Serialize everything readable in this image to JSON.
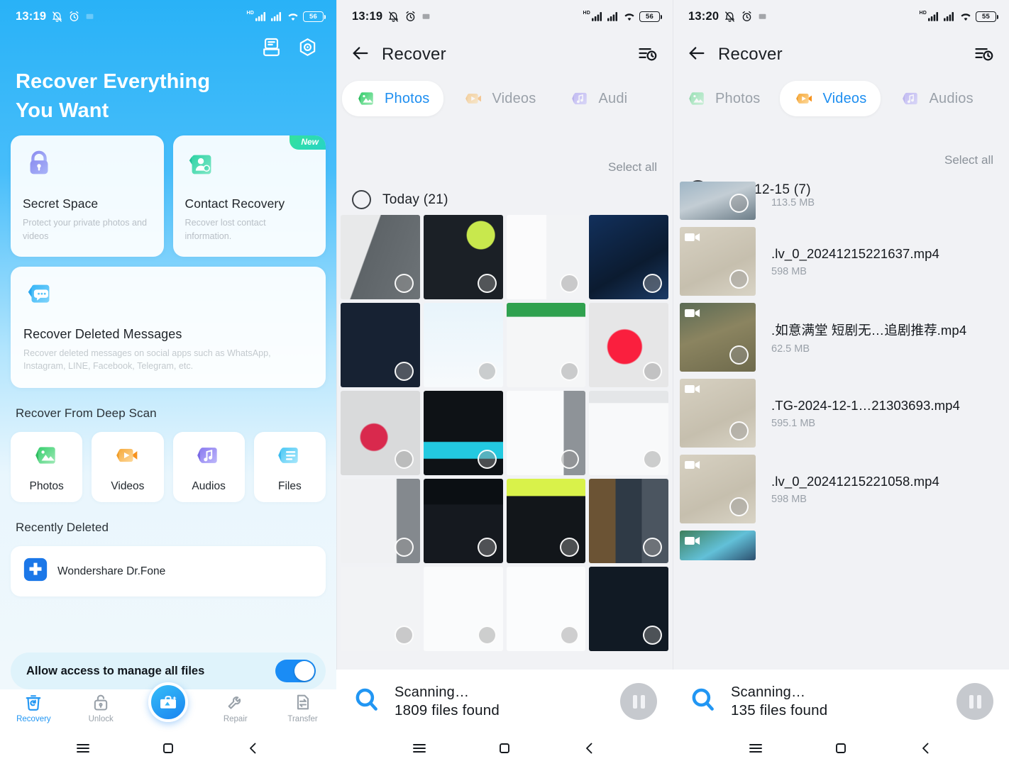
{
  "panels": {
    "home": {
      "status": {
        "time": "13:19",
        "network": "HD",
        "battery": "56"
      },
      "hero_line1": "Recover Everything",
      "hero_line2": "You Want",
      "topicons": {
        "inbox": "inbox-icon",
        "settings": "settings-icon"
      },
      "cards": [
        {
          "icon": "lock-icon",
          "title": "Secret Space",
          "sub": "Protect your private photos and videos",
          "badge": ""
        },
        {
          "icon": "contact-icon",
          "title": "Contact Recovery",
          "sub": "Recover lost contact information.",
          "badge": "New"
        }
      ],
      "wide_card": {
        "icon": "message-icon",
        "title": "Recover Deleted Messages",
        "sub": "Recover deleted messages on social apps such as WhatsApp, Instagram, LINE, Facebook, Telegram, etc."
      },
      "deep_scan_heading": "Recover From Deep Scan",
      "tiles": [
        {
          "icon": "photos-icon",
          "label": "Photos"
        },
        {
          "icon": "videos-icon",
          "label": "Videos"
        },
        {
          "icon": "audios-icon",
          "label": "Audios"
        },
        {
          "icon": "files-icon",
          "label": "Files"
        }
      ],
      "recently_deleted_heading": "Recently Deleted",
      "recently_deleted_item": {
        "icon": "drfone-icon",
        "name": "Wondershare Dr.Fone"
      },
      "permission": {
        "label": "Allow access to manage all files",
        "enabled": true
      },
      "tabbar": [
        {
          "icon": "recovery-icon",
          "label": "Recovery",
          "active": true
        },
        {
          "icon": "unlock-icon",
          "label": "Unlock",
          "active": false
        },
        {
          "icon": "toolkit-fab-icon",
          "label": "",
          "active": false
        },
        {
          "icon": "repair-icon",
          "label": "Repair",
          "active": false
        },
        {
          "icon": "transfer-icon",
          "label": "Transfer",
          "active": false
        }
      ],
      "navbar": [
        "menu-icon",
        "home-icon",
        "back-icon"
      ]
    },
    "photos": {
      "status": {
        "time": "13:19",
        "network": "HD",
        "battery": "56"
      },
      "appbar": {
        "back": "back-arrow-icon",
        "title": "Recover",
        "action": "history-icon"
      },
      "tabs": [
        {
          "icon": "photos-icon",
          "label": "Photos",
          "active": true
        },
        {
          "icon": "videos-icon",
          "label": "Videos",
          "active": false
        },
        {
          "icon": "audios-icon",
          "label": "Audi",
          "active": false
        }
      ],
      "select_all": "Select all",
      "group": {
        "label": "Today (21)",
        "checked": false
      },
      "grid_cells": [
        {
          "bg": "#d9dadd",
          "kind": "screenshot-light"
        },
        {
          "bg": "#12171c",
          "kind": "screenshot-dark"
        },
        {
          "bg": "#f4f5f7",
          "kind": "screenshot-doc"
        },
        {
          "bg": "#0e1b2e",
          "kind": "screenshot-dark-blue"
        },
        {
          "bg": "#141c28",
          "kind": "screenshot-navy"
        },
        {
          "bg": "#f2f6fa",
          "kind": "screenshot-app"
        },
        {
          "bg": "#1e8f4a",
          "kind": "screenshot-green"
        },
        {
          "bg": "#e3e3e4",
          "kind": "screenshot-red-dot"
        },
        {
          "bg": "#d3d4d6",
          "kind": "screenshot-gray"
        },
        {
          "bg": "#0d1216",
          "kind": "screenshot-tools"
        },
        {
          "bg": "#eceef0",
          "kind": "screenshot-list"
        },
        {
          "bg": "#e9eaec",
          "kind": "screenshot-settings"
        },
        {
          "bg": "#bfc2c6",
          "kind": "screenshot-menu"
        },
        {
          "bg": "#0b0f13",
          "kind": "screenshot-editor"
        },
        {
          "bg": "#12161a",
          "kind": "screenshot-promo"
        },
        {
          "bg": "#1b1b1d",
          "kind": "screenshot-gallery"
        },
        {
          "bg": "#f2f3f5",
          "kind": "screenshot-heart"
        },
        {
          "bg": "#f7f8fa",
          "kind": "screenshot-menu2"
        },
        {
          "bg": "#fafbfc",
          "kind": "screenshot-diagram"
        },
        {
          "bg": "#111a24",
          "kind": "screenshot-dark2"
        }
      ],
      "scan": {
        "line1": "Scanning…",
        "line2": "1809 files found",
        "icon": "search-icon",
        "pause": "pause-icon"
      },
      "navbar": [
        "menu-icon",
        "home-icon",
        "back-icon"
      ]
    },
    "videos": {
      "status": {
        "time": "13:20",
        "network": "HD",
        "battery": "55"
      },
      "appbar": {
        "back": "back-arrow-icon",
        "title": "Recover",
        "action": "history-icon"
      },
      "tabs": [
        {
          "icon": "photos-icon",
          "label": "Photos",
          "active": false
        },
        {
          "icon": "videos-icon",
          "label": "Videos",
          "active": true
        },
        {
          "icon": "audios-icon",
          "label": "Audios",
          "active": false
        }
      ],
      "select_all": "Select all",
      "group": {
        "label": "2024-12-15 (7)",
        "checked": false
      },
      "files": [
        {
          "name": "",
          "size": "113.5 MB",
          "thumb": "#b9c4cc",
          "partial": true
        },
        {
          "name": ".lv_0_20241215221637.mp4",
          "size": "598 MB",
          "thumb": "#cfc9bb"
        },
        {
          "name": ".如意满堂 短剧无…追剧推荐.mp4",
          "size": "62.5 MB",
          "thumb": "#7e7a5e"
        },
        {
          "name": ".TG-2024-12-1…21303693.mp4",
          "size": "595.1 MB",
          "thumb": "#cfc9bb"
        },
        {
          "name": ".lv_0_20241215221058.mp4",
          "size": "598 MB",
          "thumb": "#cfc9bb"
        },
        {
          "name": "",
          "size": "",
          "thumb": "#3a9cc4",
          "partial": true
        }
      ],
      "scan": {
        "line1": "Scanning…",
        "line2": "135 files found",
        "icon": "search-icon",
        "pause": "pause-icon"
      },
      "navbar": [
        "menu-icon",
        "home-icon",
        "back-icon"
      ]
    }
  }
}
